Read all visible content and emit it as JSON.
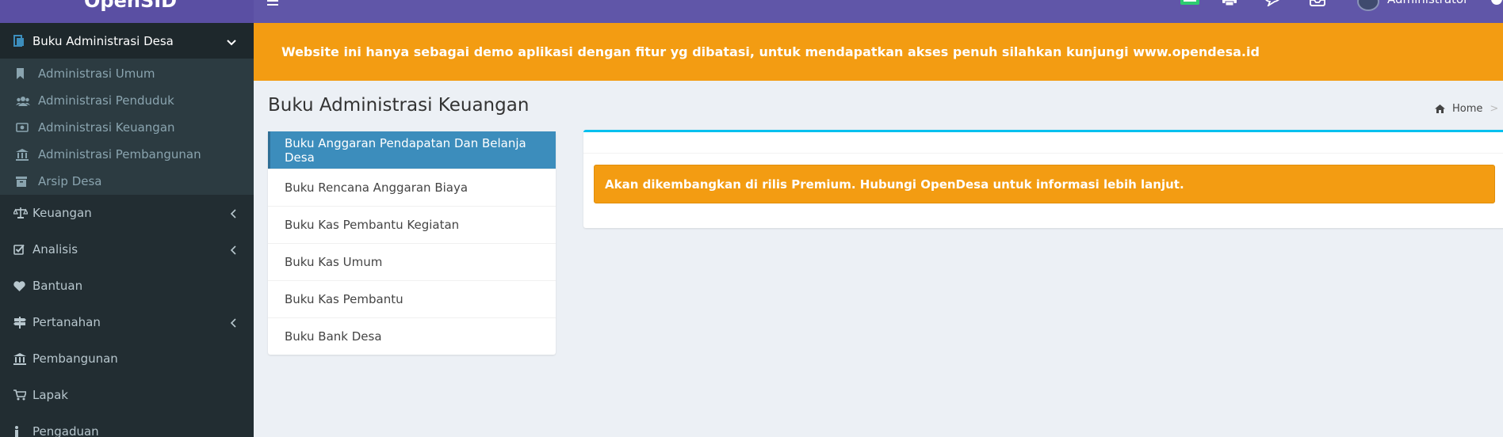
{
  "brand": {
    "title": "OpenSID"
  },
  "topbar": {
    "user_name": "Administrator"
  },
  "banner": {
    "text": "Website ini hanya sebagai demo aplikasi dengan fitur yg dibatasi, untuk mendapatkan akses penuh silahkan kunjungi www.opendesa.id"
  },
  "sidebar": {
    "open_menu": {
      "label": "Buku Administrasi Desa",
      "icon": "book-icon"
    },
    "submenu": [
      {
        "label": "Administrasi Umum",
        "icon": "bookmark-icon"
      },
      {
        "label": "Administrasi Penduduk",
        "icon": "users-icon"
      },
      {
        "label": "Administrasi Keuangan",
        "icon": "money-icon"
      },
      {
        "label": "Administrasi Pembangunan",
        "icon": "bank-icon"
      },
      {
        "label": "Arsip Desa",
        "icon": "archive-icon"
      }
    ],
    "items": [
      {
        "label": "Keuangan",
        "icon": "balance-scale-icon",
        "has_children": true
      },
      {
        "label": "Analisis",
        "icon": "check-square-icon",
        "has_children": true
      },
      {
        "label": "Bantuan",
        "icon": "heart-icon",
        "has_children": false
      },
      {
        "label": "Pertanahan",
        "icon": "signpost-icon",
        "has_children": true
      },
      {
        "label": "Pembangunan",
        "icon": "bank-icon",
        "has_children": false
      },
      {
        "label": "Lapak",
        "icon": "cart-icon",
        "has_children": false
      },
      {
        "label": "Pengaduan",
        "icon": "info-icon",
        "has_children": false
      }
    ]
  },
  "page": {
    "title": "Buku Administrasi Keuangan",
    "breadcrumb": {
      "home": "Home",
      "separator": ">"
    }
  },
  "book_list": [
    {
      "label": "Buku Anggaran Pendapatan Dan Belanja Desa",
      "active": true
    },
    {
      "label": "Buku Rencana Anggaran Biaya",
      "active": false
    },
    {
      "label": "Buku Kas Pembantu Kegiatan",
      "active": false
    },
    {
      "label": "Buku Kas Umum",
      "active": false
    },
    {
      "label": "Buku Kas Pembantu",
      "active": false
    },
    {
      "label": "Buku Bank Desa",
      "active": false
    }
  ],
  "alert": {
    "text": "Akan dikembangkan di rilis Premium. Hubungi OpenDesa untuk informasi lebih lanjut."
  },
  "colors": {
    "sidebar_bg": "#222d32",
    "topbar_bg": "#6056a8",
    "banner_bg": "#f39c12",
    "active_item_bg": "#3c8dbc",
    "box_accent": "#00c0ef"
  }
}
